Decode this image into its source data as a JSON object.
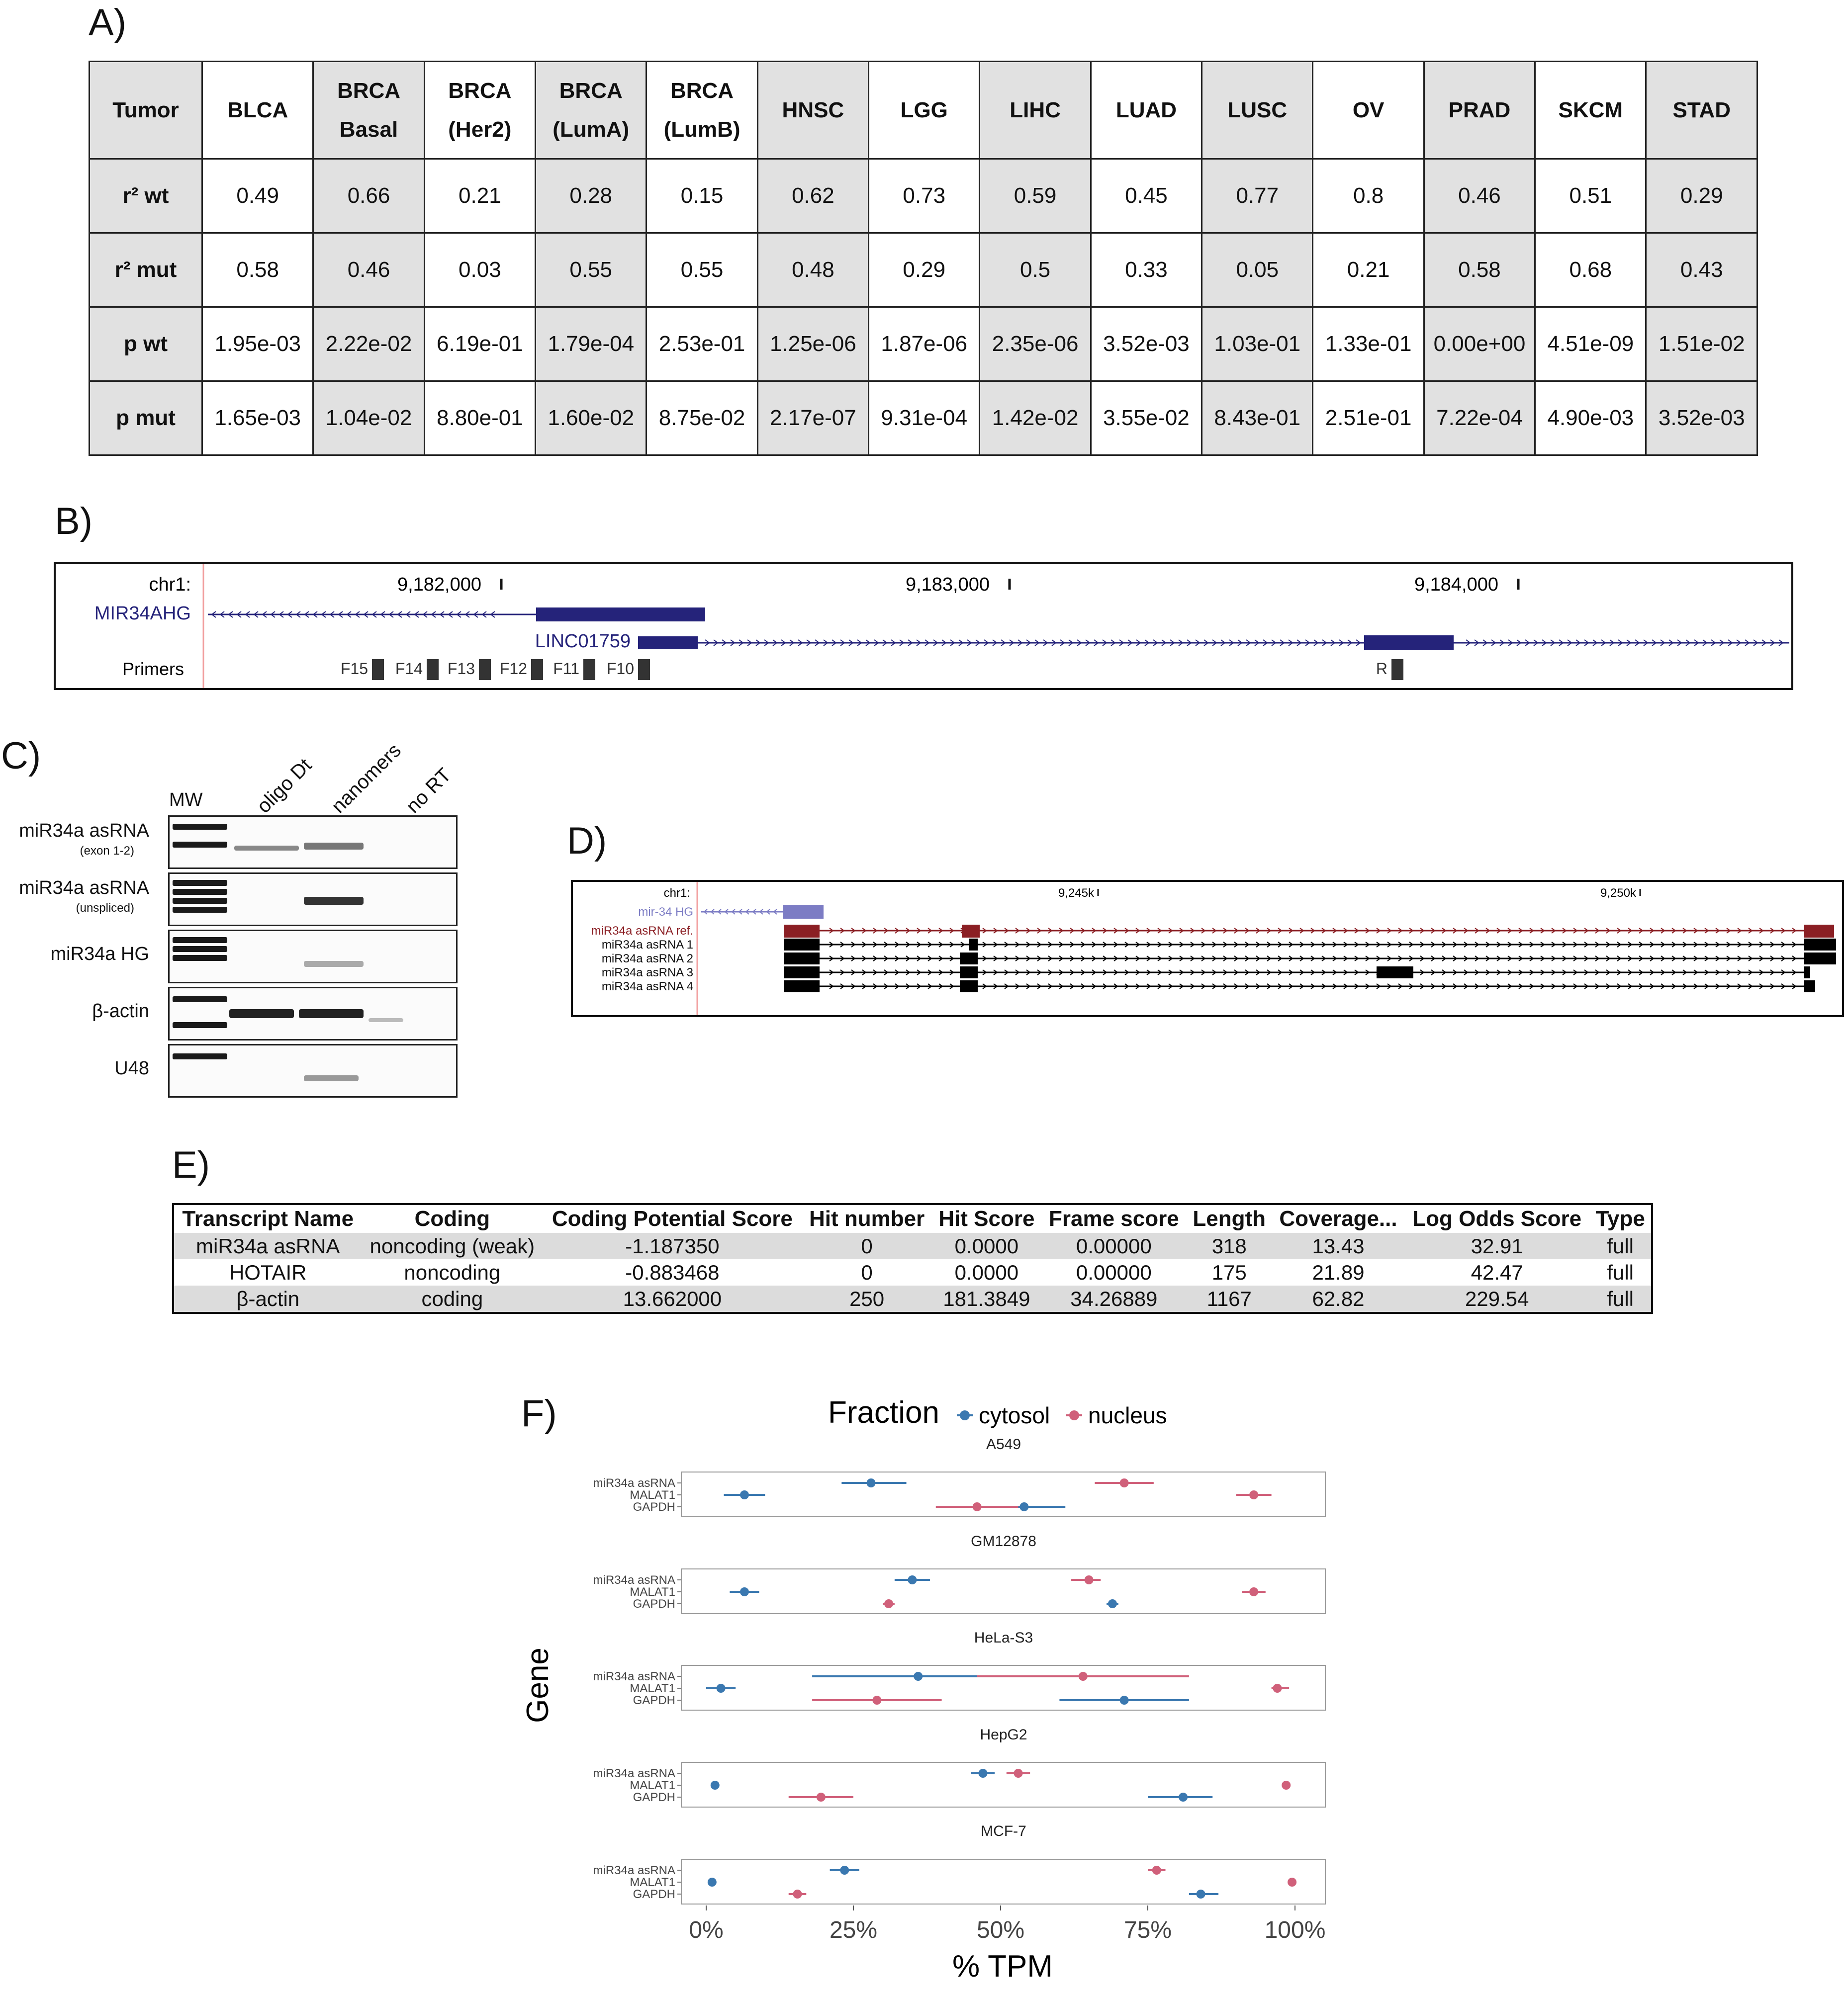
{
  "panel_letters": {
    "a": "A)",
    "b": "B)",
    "c": "C)",
    "d": "D)",
    "e": "E)",
    "f": "F)"
  },
  "panelA": {
    "corner": "Tumor",
    "columns": [
      {
        "l1": "BLCA",
        "l2": ""
      },
      {
        "l1": "BRCA",
        "l2": "Basal"
      },
      {
        "l1": "BRCA",
        "l2": "(Her2)"
      },
      {
        "l1": "BRCA",
        "l2": "(LumA)"
      },
      {
        "l1": "BRCA",
        "l2": "(LumB)"
      },
      {
        "l1": "HNSC",
        "l2": ""
      },
      {
        "l1": "LGG",
        "l2": ""
      },
      {
        "l1": "LIHC",
        "l2": ""
      },
      {
        "l1": "LUAD",
        "l2": ""
      },
      {
        "l1": "LUSC",
        "l2": ""
      },
      {
        "l1": "OV",
        "l2": ""
      },
      {
        "l1": "PRAD",
        "l2": ""
      },
      {
        "l1": "SKCM",
        "l2": ""
      },
      {
        "l1": "STAD",
        "l2": ""
      }
    ],
    "rows": [
      {
        "label": "r² wt",
        "values": [
          "0.49",
          "0.66",
          "0.21",
          "0.28",
          "0.15",
          "0.62",
          "0.73",
          "0.59",
          "0.45",
          "0.77",
          "0.8",
          "0.46",
          "0.51",
          "0.29"
        ]
      },
      {
        "label": "r² mut",
        "values": [
          "0.58",
          "0.46",
          "0.03",
          "0.55",
          "0.55",
          "0.48",
          "0.29",
          "0.5",
          "0.33",
          "0.05",
          "0.21",
          "0.58",
          "0.68",
          "0.43"
        ]
      },
      {
        "label": "p wt",
        "values": [
          "1.95e-03",
          "2.22e-02",
          "6.19e-01",
          "1.79e-04",
          "2.53e-01",
          "1.25e-06",
          "1.87e-06",
          "2.35e-06",
          "3.52e-03",
          "1.03e-01",
          "1.33e-01",
          "0.00e+00",
          "4.51e-09",
          "1.51e-02"
        ]
      },
      {
        "label": "p mut",
        "values": [
          "1.65e-03",
          "1.04e-02",
          "8.80e-01",
          "1.60e-02",
          "8.75e-02",
          "2.17e-07",
          "9.31e-04",
          "1.42e-02",
          "3.55e-02",
          "8.43e-01",
          "2.51e-01",
          "7.22e-04",
          "4.90e-03",
          "3.52e-03"
        ]
      }
    ],
    "shaded_columns": [
      1,
      3,
      5,
      7,
      9,
      11,
      13
    ]
  },
  "panelB": {
    "chrom": "chr1:",
    "coords": [
      "9,182,000",
      "9,183,000",
      "9,184,000"
    ],
    "gene1": "MIR34AHG",
    "gene2": "LINC01759",
    "primers_label": "Primers",
    "primers": [
      "F15",
      "F14",
      "F13",
      "F12",
      "F11",
      "F10",
      "R"
    ],
    "gene_color": "#25237a"
  },
  "panelC": {
    "lanes": [
      "MW",
      "oligo Dt",
      "nanomers",
      "no RT"
    ],
    "gels": [
      {
        "name": "miR34a asRNA",
        "sub": "(exon 1-2)"
      },
      {
        "name": "miR34a asRNA",
        "sub": "(unspliced)"
      },
      {
        "name": "miR34a HG",
        "sub": ""
      },
      {
        "name": "β-actin",
        "sub": ""
      },
      {
        "name": "U48",
        "sub": ""
      }
    ]
  },
  "panelD": {
    "chrom": "chr1:",
    "coords": [
      "9,245k",
      "9,250k"
    ],
    "tracks": [
      "mir-34 HG",
      "miR34a asRNA ref.",
      "miR34a asRNA 1",
      "miR34a asRNA 2",
      "miR34a asRNA 3",
      "miR34a asRNA 4"
    ],
    "colors": {
      "hg": "#7c7cc4",
      "ref": "#8b1f24",
      "iso": "#000000"
    }
  },
  "panelE": {
    "headers": [
      "Transcript Name",
      "Coding",
      "Coding Potential Score",
      "Hit number",
      "Hit Score",
      "Frame score",
      "Length",
      "Coverage...",
      "Log Odds Score",
      "Type"
    ],
    "rows": [
      [
        "miR34a asRNA",
        "noncoding (weak)",
        "-1.187350",
        "0",
        "0.0000",
        "0.00000",
        "318",
        "13.43",
        "32.91",
        "full"
      ],
      [
        "HOTAIR",
        "noncoding",
        "-0.883468",
        "0",
        "0.0000",
        "0.00000",
        "175",
        "21.89",
        "42.47",
        "full"
      ],
      [
        "β-actin",
        "coding",
        "13.662000",
        "250",
        "181.3849",
        "34.26889",
        "1167",
        "62.82",
        "229.54",
        "full"
      ]
    ]
  },
  "chart_data": {
    "type": "scatter",
    "legend_title": "Fraction",
    "legend_position": "top",
    "series_names": [
      "cytosol",
      "nucleus"
    ],
    "colors": {
      "cytosol": "#3a78b0",
      "nucleus": "#d0607a"
    },
    "genes": [
      "miR34a asRNA",
      "MALAT1",
      "GAPDH"
    ],
    "xlabel": "% TPM",
    "ylabel": "Gene",
    "xlim": [
      0,
      100
    ],
    "xticks": [
      "0%",
      "25%",
      "50%",
      "75%",
      "100%"
    ],
    "facets": [
      {
        "name": "A549",
        "cytosol": [
          [
            28,
            23,
            34
          ],
          [
            6.5,
            3,
            10
          ],
          [
            54,
            47,
            61
          ]
        ],
        "nucleus": [
          [
            71,
            66,
            76
          ],
          [
            93,
            90,
            96
          ],
          [
            46,
            39,
            53
          ]
        ]
      },
      {
        "name": "GM12878",
        "cytosol": [
          [
            35,
            32,
            38
          ],
          [
            6.5,
            4,
            9
          ],
          [
            69,
            68,
            70
          ]
        ],
        "nucleus": [
          [
            65,
            62,
            67
          ],
          [
            93,
            91,
            95
          ],
          [
            31,
            30,
            32
          ]
        ]
      },
      {
        "name": "HeLa-S3",
        "cytosol": [
          [
            36,
            18,
            54
          ],
          [
            2.5,
            0,
            5
          ],
          [
            71,
            60,
            82
          ]
        ],
        "nucleus": [
          [
            64,
            46,
            82
          ],
          [
            97,
            96,
            99
          ],
          [
            29,
            18,
            40
          ]
        ]
      },
      {
        "name": "HepG2",
        "cytosol": [
          [
            47,
            45,
            49
          ],
          [
            1.5,
            1,
            2
          ],
          [
            81,
            75,
            86
          ]
        ],
        "nucleus": [
          [
            53,
            51,
            55
          ],
          [
            98.5,
            98,
            99
          ],
          [
            19.5,
            14,
            25
          ]
        ]
      },
      {
        "name": "MCF-7",
        "cytosol": [
          [
            23.5,
            21,
            26
          ],
          [
            1,
            1,
            1
          ],
          [
            84,
            82,
            87
          ]
        ],
        "nucleus": [
          [
            76.5,
            75,
            78
          ],
          [
            99.5,
            99,
            100
          ],
          [
            15.5,
            14,
            17
          ]
        ]
      }
    ]
  }
}
